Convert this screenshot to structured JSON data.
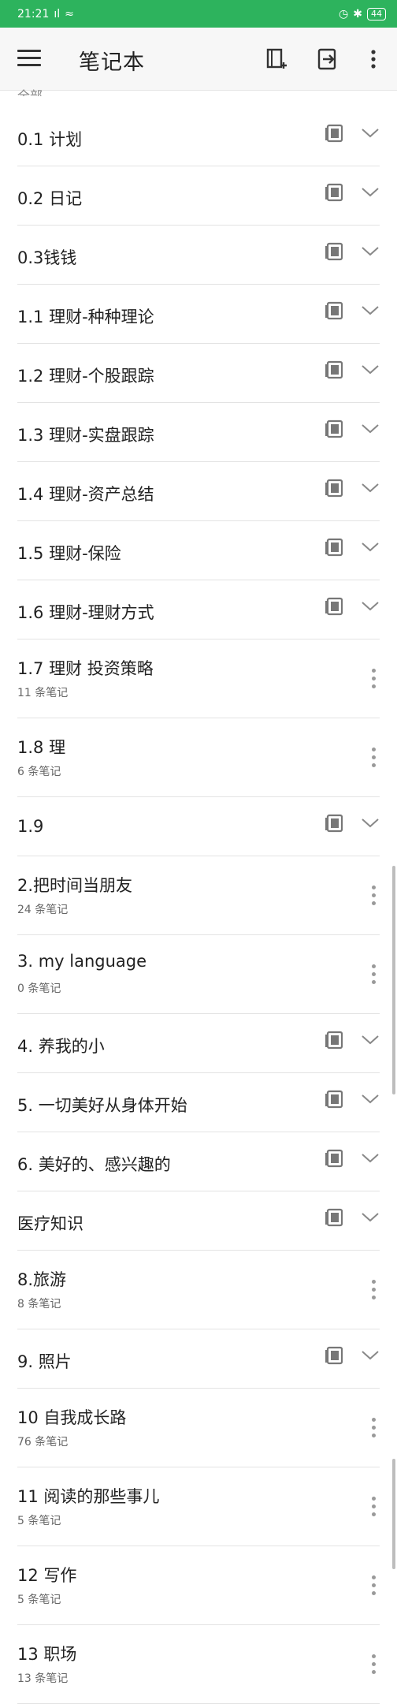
{
  "status": {
    "time": "21:21",
    "signal": "4G",
    "battery": "44"
  },
  "toolbar": {
    "title": "笔记本",
    "menu_icon": "menu-icon",
    "add_notebook_icon": "add-notebook-icon",
    "export_icon": "export-icon",
    "more_icon": "more-vert-icon"
  },
  "partial_label": "全部",
  "notebooks": [
    {
      "name": "0.1 计划",
      "type": "stack"
    },
    {
      "name": "0.2 日记",
      "type": "stack"
    },
    {
      "name": "0.3钱钱",
      "type": "stack"
    },
    {
      "name": "1.1 理财-种种理论",
      "type": "stack"
    },
    {
      "name": "1.2 理财-个股跟踪",
      "type": "stack"
    },
    {
      "name": "1.3 理财-实盘跟踪",
      "type": "stack"
    },
    {
      "name": "1.4 理财-资产总结",
      "type": "stack"
    },
    {
      "name": "1.5 理财-保险",
      "type": "stack"
    },
    {
      "name": "1.6 理财-理财方式",
      "type": "stack"
    },
    {
      "name": "1.7 理财 投资策略",
      "count": "11 条笔记",
      "type": "single"
    },
    {
      "name": "1.8 理",
      "count": "6 条笔记",
      "type": "single"
    },
    {
      "name": "1.9",
      "type": "stack"
    },
    {
      "name": "2.把时间当朋友",
      "count": "24 条笔记",
      "type": "single"
    },
    {
      "name": "3. my language",
      "count": "0 条笔记",
      "type": "single"
    },
    {
      "name": "4. 养我的小",
      "type": "stack"
    },
    {
      "name": "5. 一切美好从身体开始",
      "type": "stack"
    },
    {
      "name": "6. 美好的、感兴趣的",
      "type": "stack"
    },
    {
      "name": "医疗知识",
      "type": "stack"
    },
    {
      "name": "8.旅游",
      "count": "8 条笔记",
      "type": "single"
    },
    {
      "name": "9. 照片",
      "type": "stack"
    },
    {
      "name": "10 自我成长路",
      "count": "76 条笔记",
      "type": "single"
    },
    {
      "name": "11 阅读的那些事儿",
      "count": "5 条笔记",
      "type": "single"
    },
    {
      "name": "12 写作",
      "count": "5 条笔记",
      "type": "single"
    },
    {
      "name": "13 职场",
      "count": "13 条笔记",
      "type": "single"
    }
  ]
}
